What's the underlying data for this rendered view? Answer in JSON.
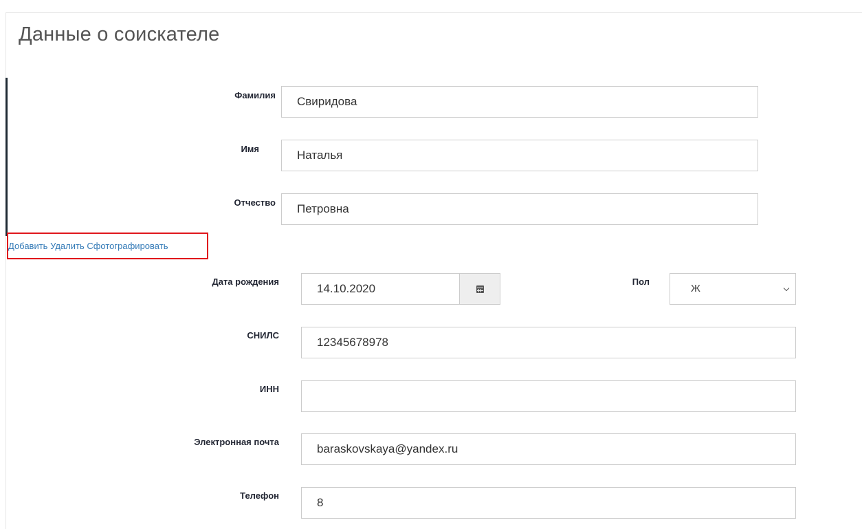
{
  "page": {
    "title": "Данные о соискателе"
  },
  "photo_actions": {
    "add": "Добавить",
    "delete": "Удалить",
    "take_photo": "Сфотографировать"
  },
  "fields": {
    "surname": {
      "label": "Фамилия",
      "value": "Свиридова"
    },
    "name": {
      "label": "Имя",
      "value": "Наталья"
    },
    "patronymic": {
      "label": "Отчество",
      "value": "Петровна"
    },
    "birth_date": {
      "label": "Дата рождения",
      "value": "14.10.2020"
    },
    "gender": {
      "label": "Пол",
      "value": "Ж"
    },
    "snils": {
      "label": "СНИЛС",
      "value": "12345678978"
    },
    "inn": {
      "label": "ИНН",
      "value": ""
    },
    "email": {
      "label": "Электронная почта",
      "value": "baraskovskaya@yandex.ru"
    },
    "phone": {
      "label": "Телефон",
      "value": "8"
    }
  },
  "icons": {
    "calendar": "calendar-icon",
    "dropdown": "chevron-down-icon"
  },
  "colors": {
    "link": "#337ab7",
    "highlight": "#e0161c",
    "label": "#222633"
  }
}
